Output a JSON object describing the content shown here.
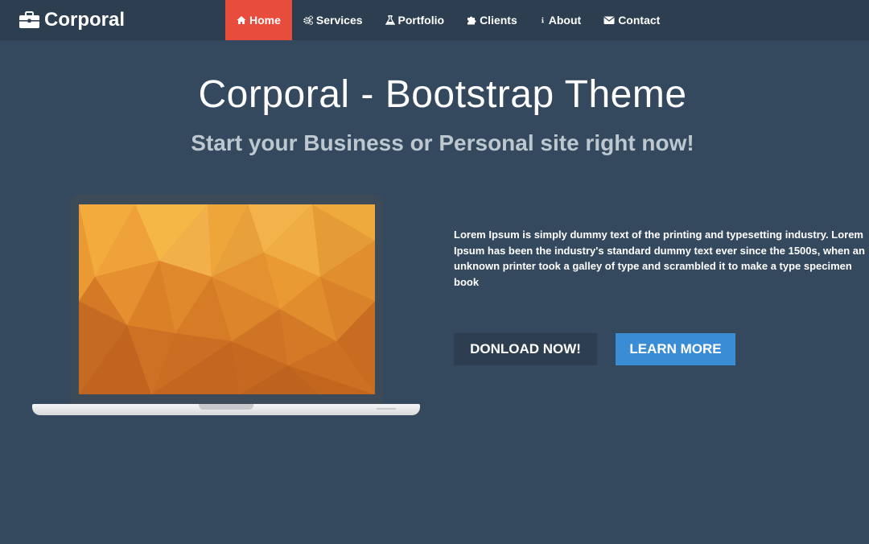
{
  "brand": {
    "name": "Corporal",
    "icon": "briefcase-icon"
  },
  "nav": {
    "items": [
      {
        "label": "Home",
        "icon": "home-icon",
        "active": true
      },
      {
        "label": "Services",
        "icon": "gears-icon",
        "active": false
      },
      {
        "label": "Portfolio",
        "icon": "flask-icon",
        "active": false
      },
      {
        "label": "Clients",
        "icon": "puzzle-icon",
        "active": false
      },
      {
        "label": "About",
        "icon": "info-icon",
        "active": false
      },
      {
        "label": "Contact",
        "icon": "envelope-icon",
        "active": false
      }
    ]
  },
  "hero": {
    "title": "Corporal - Bootstrap Theme",
    "subtitle": "Start your Business or Personal site right now!",
    "blurb": "Lorem Ipsum is simply dummy text of the printing and typesetting industry. Lorem Ipsum has been the industry's standard dummy text ever since the 1500s, when an unknown printer took a galley of type and scrambled it to make a type specimen book",
    "download_label": "DONLOAD NOW!",
    "learn_label": "LEARN MORE"
  },
  "colors": {
    "background": "#34495e",
    "navbar": "#2c3e50",
    "active_nav": "#e74c3c",
    "download_button": "#2c3e50",
    "learn_button": "#3a8dd4",
    "subtitle": "#bdc7d0"
  }
}
